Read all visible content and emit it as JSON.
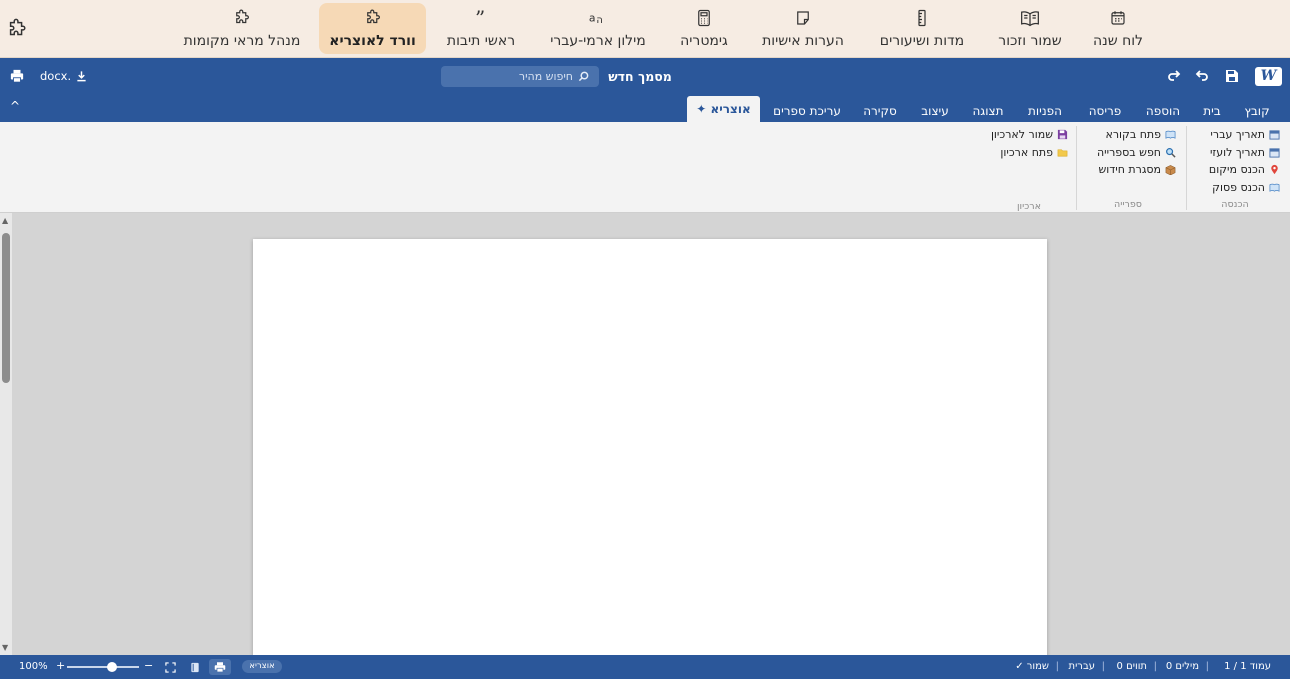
{
  "app_nav": {
    "items": [
      {
        "label": "לוח שנה",
        "icon": "calendar-icon"
      },
      {
        "label": "שמור וזכור",
        "icon": "open-book-icon"
      },
      {
        "label": "מדות ושיעורים",
        "icon": "ruler-icon"
      },
      {
        "label": "הערות אישיות",
        "icon": "sticky-note-icon"
      },
      {
        "label": "גימטריה",
        "icon": "calculator-icon"
      },
      {
        "label": "מילון ארמי-עברי",
        "icon": "translate-icon"
      },
      {
        "label": "ראשי תיבות",
        "icon": "quote-icon"
      },
      {
        "label": "וורד לאוצריא",
        "icon": "puzzle-icon",
        "active": true
      },
      {
        "label": "מנהל מראי מקומות",
        "icon": "puzzle-icon"
      }
    ]
  },
  "titlebar": {
    "logo": "W",
    "doc_title": "מסמך חדש",
    "search_placeholder": "חיפוש מהיר",
    "download_label": "docx."
  },
  "ribbon": {
    "tabs": [
      "קובץ",
      "בית",
      "הוספה",
      "פריסה",
      "הפניות",
      "תצוגה",
      "עיצוב",
      "סקירה",
      "עריכת ספרים",
      "✦ אוצריא"
    ],
    "active_tab": "✦ אוצריא",
    "collapse": "^",
    "groups": [
      {
        "name": "הכנסה",
        "commands": [
          {
            "label": "תאריך עברי",
            "icon": "calendar-icon"
          },
          {
            "label": "תאריך לועזי",
            "icon": "calendar-icon"
          },
          {
            "label": "הכנס מיקום",
            "icon": "pin-icon"
          },
          {
            "label": "הכנס פסוק",
            "icon": "book-icon"
          }
        ]
      },
      {
        "name": "ספרייה",
        "commands": [
          {
            "label": "פתח בקורא",
            "icon": "book-icon"
          },
          {
            "label": "חפש בספרייה",
            "icon": "magnifier-icon"
          },
          {
            "label": "מסגרת חידוש",
            "icon": "box-icon"
          }
        ]
      },
      {
        "name": "ארכיון",
        "commands": [
          {
            "label": "שמור לארכיון",
            "icon": "floppy-icon"
          },
          {
            "label": "פתח ארכיון",
            "icon": "folder-icon"
          }
        ]
      }
    ]
  },
  "statusbar": {
    "page": "עמוד 1 / 1",
    "words": "0 מילים",
    "chars": "0 תווים",
    "language": "עברית",
    "saved": "✓ שמור",
    "otzaria": "אוצריא",
    "zoom": "100%",
    "zoom_plus": "+",
    "zoom_minus": "−",
    "zoom_fraction": 0.62
  },
  "colors": {
    "brand_blue": "#2b579a",
    "nav_bg": "#f6ece3",
    "nav_active": "#f6d9b6"
  }
}
